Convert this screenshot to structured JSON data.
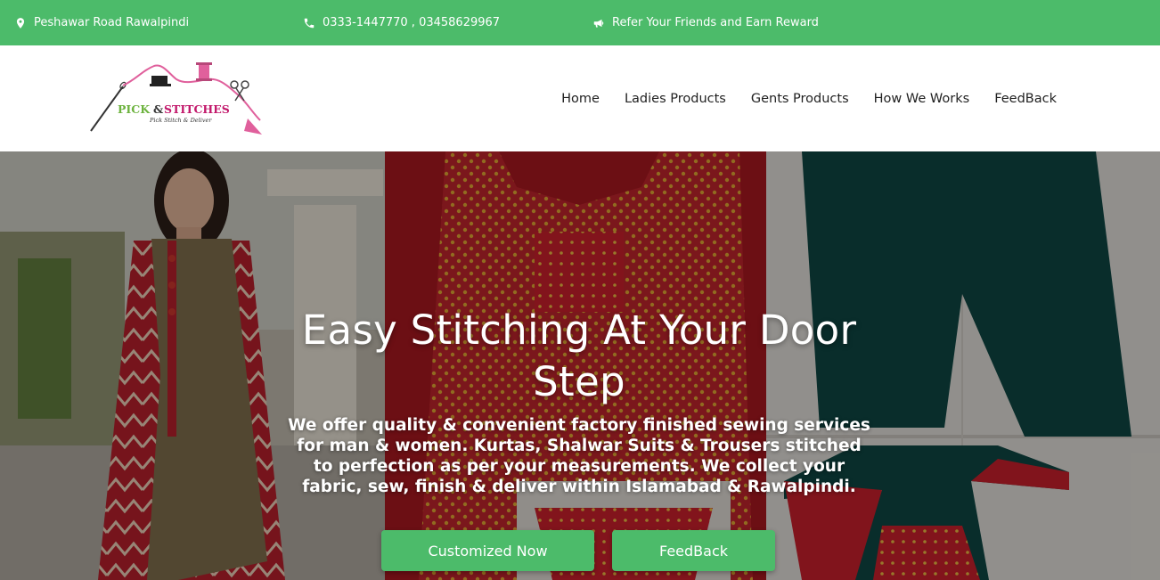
{
  "topbar": {
    "address": "Peshawar Road Rawalpindi",
    "address_icon": "map-pin-icon",
    "phones": "0333-1447770 , 03458629967",
    "phone_icon": "phone-icon",
    "referral": "Refer Your Friends and Earn Reward",
    "referral_icon": "megaphone-icon",
    "bg_color": "#4cbb6a"
  },
  "logo": {
    "brand_left": "PICK",
    "brand_amp": "&",
    "brand_right": "STITCHES",
    "tagline": "Pick Stitch & Deliver"
  },
  "nav": {
    "items": [
      {
        "label": "Home"
      },
      {
        "label": "Ladies Products"
      },
      {
        "label": "Gents Products"
      },
      {
        "label": "How We Works"
      },
      {
        "label": "FeedBack"
      }
    ]
  },
  "hero": {
    "title": "Easy Stitching At Your Door Step",
    "description": "We offer quality & convenient factory finished sewing services for man & women. Kurtas, Shalwar Suits & Trousers stitched to perfection as per your measurements. We collect your fabric, sew, finish & deliver within Islamabad & Rawalpindi.",
    "primary_button": "Customized Now",
    "secondary_button": "FeedBack",
    "accent_color": "#4cbb6a"
  }
}
